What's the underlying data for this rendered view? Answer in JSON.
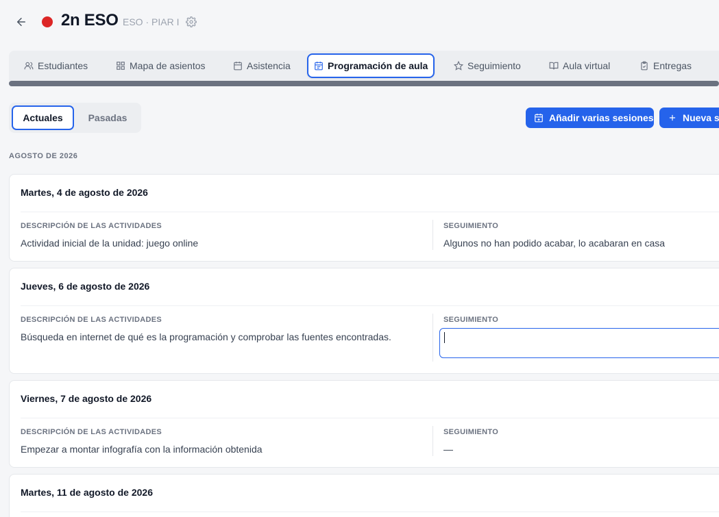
{
  "header": {
    "title": "2n ESO",
    "subtitle": "ESO · PIAR I",
    "group_color": "#dc2626"
  },
  "tabs": [
    {
      "label": "Estudiantes",
      "icon": "users-icon"
    },
    {
      "label": "Mapa de asientos",
      "icon": "grid-icon"
    },
    {
      "label": "Asistencia",
      "icon": "calendar-icon"
    },
    {
      "label": "Programación de aula",
      "icon": "calendar-list-icon",
      "active": true
    },
    {
      "label": "Seguimiento",
      "icon": "star-icon"
    },
    {
      "label": "Aula virtual",
      "icon": "book-icon"
    },
    {
      "label": "Entregas",
      "icon": "clipboard-icon"
    }
  ],
  "filter": {
    "current_label": "Actuales",
    "past_label": "Pasadas",
    "selected": "Actuales"
  },
  "actions": {
    "add_multiple_label": "Añadir varias sesiones",
    "new_session_label": "Nueva se"
  },
  "month_heading": "AGOSTO DE 2026",
  "labels": {
    "description": "DESCRIPCIÓN DE LAS ACTIVIDADES",
    "followup": "SEGUIMIENTO"
  },
  "sessions": [
    {
      "date": "Martes, 4 de agosto de 2026",
      "description": "Actividad inicial de la unidad: juego online",
      "followup": "Algunos no han podido acabar, lo acabaran en casa"
    },
    {
      "date": "Jueves, 6 de agosto de 2026",
      "description": "Búsqueda en internet de qué es la programación y comprobar las fuentes encontradas.",
      "followup": ""
    },
    {
      "date": "Viernes, 7 de agosto de 2026",
      "description": "Empezar a montar infografía con la información obtenida",
      "followup": "—"
    },
    {
      "date": "Martes, 11 de agosto de 2026"
    }
  ],
  "colors": {
    "accent": "#2563eb",
    "page_background": "#f5f6f8"
  }
}
